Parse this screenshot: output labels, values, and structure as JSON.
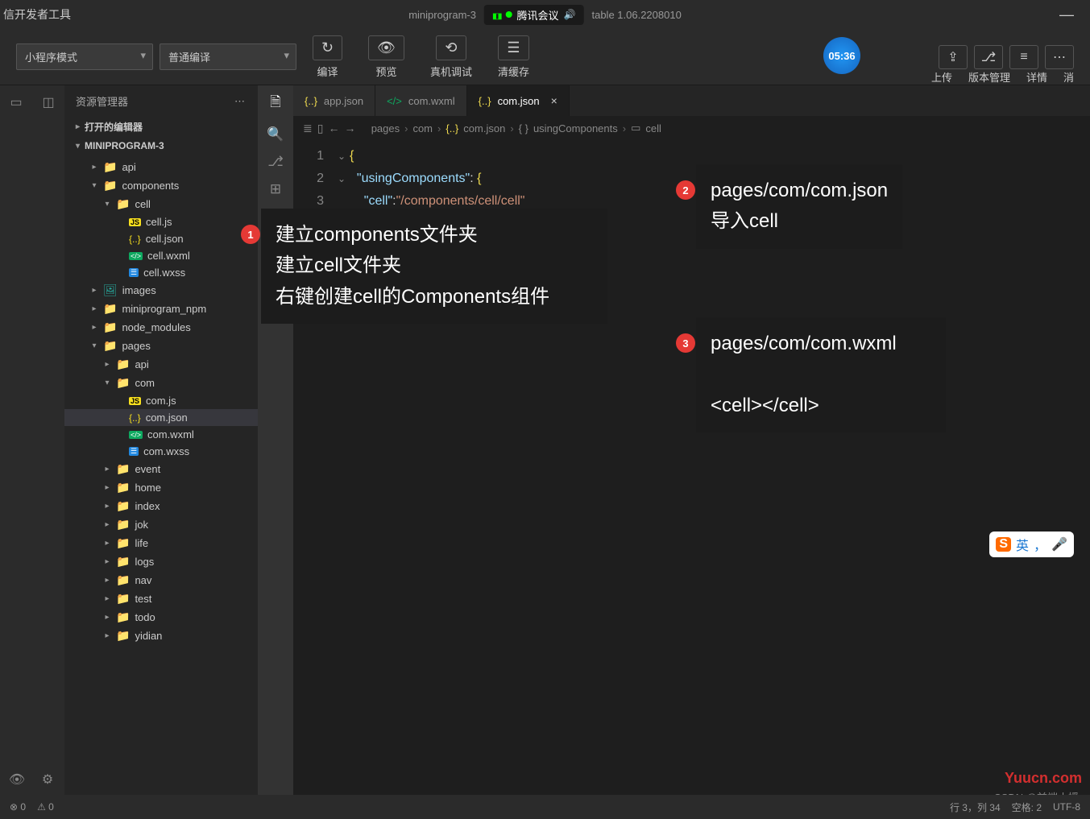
{
  "titlebar": {
    "appName": "信开发者工具",
    "project": "miniprogram-3",
    "version": "table 1.06.2208010",
    "meetingApp": "腾讯会议"
  },
  "toolbar": {
    "modeSelect": "小程序模式",
    "compileSelect": "普通编译",
    "compile": "编译",
    "preview": "预览",
    "realDebug": "真机调试",
    "clearCache": "清缓存",
    "timer": "05:36",
    "upload": "上传",
    "versionMgmt": "版本管理",
    "details": "详情",
    "more": "消"
  },
  "sidebar": {
    "title": "资源管理器",
    "openEditors": "打开的编辑器",
    "project": "MINIPROGRAM-3",
    "tree": [
      {
        "name": "api",
        "type": "folder-y",
        "indent": 2,
        "expand": "▸"
      },
      {
        "name": "components",
        "type": "folder-g",
        "indent": 2,
        "expand": "▾"
      },
      {
        "name": "cell",
        "type": "folder",
        "indent": 3,
        "expand": "▾"
      },
      {
        "name": "cell.js",
        "type": "js",
        "indent": 4
      },
      {
        "name": "cell.json",
        "type": "json",
        "indent": 4
      },
      {
        "name": "cell.wxml",
        "type": "wxml",
        "indent": 4
      },
      {
        "name": "cell.wxss",
        "type": "wxss",
        "indent": 4
      },
      {
        "name": "images",
        "type": "folder-img",
        "indent": 2,
        "expand": "▸"
      },
      {
        "name": "miniprogram_npm",
        "type": "folder",
        "indent": 2,
        "expand": "▸"
      },
      {
        "name": "node_modules",
        "type": "folder",
        "indent": 2,
        "expand": "▸"
      },
      {
        "name": "pages",
        "type": "folder-g",
        "indent": 2,
        "expand": "▾"
      },
      {
        "name": "api",
        "type": "folder-y",
        "indent": 3,
        "expand": "▸"
      },
      {
        "name": "com",
        "type": "folder",
        "indent": 3,
        "expand": "▾"
      },
      {
        "name": "com.js",
        "type": "js",
        "indent": 4
      },
      {
        "name": "com.json",
        "type": "json",
        "indent": 4,
        "selected": true
      },
      {
        "name": "com.wxml",
        "type": "wxml",
        "indent": 4
      },
      {
        "name": "com.wxss",
        "type": "wxss",
        "indent": 4
      },
      {
        "name": "event",
        "type": "folder-y",
        "indent": 3,
        "expand": "▸"
      },
      {
        "name": "home",
        "type": "folder-y",
        "indent": 3,
        "expand": "▸"
      },
      {
        "name": "index",
        "type": "folder-y",
        "indent": 3,
        "expand": "▸"
      },
      {
        "name": "jok",
        "type": "folder-y",
        "indent": 3,
        "expand": "▸"
      },
      {
        "name": "life",
        "type": "folder-y",
        "indent": 3,
        "expand": "▸"
      },
      {
        "name": "logs",
        "type": "folder-y",
        "indent": 3,
        "expand": "▸"
      },
      {
        "name": "nav",
        "type": "folder-y",
        "indent": 3,
        "expand": "▸"
      },
      {
        "name": "test",
        "type": "folder-t",
        "indent": 3,
        "expand": "▸"
      },
      {
        "name": "todo",
        "type": "folder-y",
        "indent": 3,
        "expand": "▸"
      },
      {
        "name": "yidian",
        "type": "folder-y",
        "indent": 3,
        "expand": "▸"
      }
    ]
  },
  "tabs": [
    {
      "name": "app.json",
      "icon": "json",
      "active": false
    },
    {
      "name": "com.wxml",
      "icon": "wxml",
      "active": false
    },
    {
      "name": "com.json",
      "icon": "json",
      "active": true
    }
  ],
  "breadcrumb": {
    "seg1": "pages",
    "seg2": "com",
    "seg3": "com.json",
    "seg4": "usingComponents",
    "seg5": "cell"
  },
  "code": {
    "line1_brace": "{",
    "line2_key": "\"usingComponents\"",
    "line2_colon": ":",
    "line2_brace": "{",
    "line3_key": "\"cell\"",
    "line3_colon": ":",
    "line3_val": "\"/components/cell/cell\"",
    "line4_brace": "}"
  },
  "annotations": {
    "a1_l1": "建立components文件夹",
    "a1_l2": "建立cell文件夹",
    "a1_l3": "右键创建cell的Components组件",
    "a2_l1": "pages/com/com.json",
    "a2_l2": "导入cell",
    "a3_l1": "pages/com/com.wxml",
    "a3_l2": "<cell></cell>"
  },
  "statusbar": {
    "errors": "0",
    "warnings": "0",
    "lineCol": "行 3，列 34",
    "spaces": "空格: 2",
    "encoding": "UTF-8"
  },
  "ime": {
    "mode": "英",
    "dots": "，"
  },
  "watermark": "Yuucn.com",
  "csdn": "CSDN @前端小媛"
}
